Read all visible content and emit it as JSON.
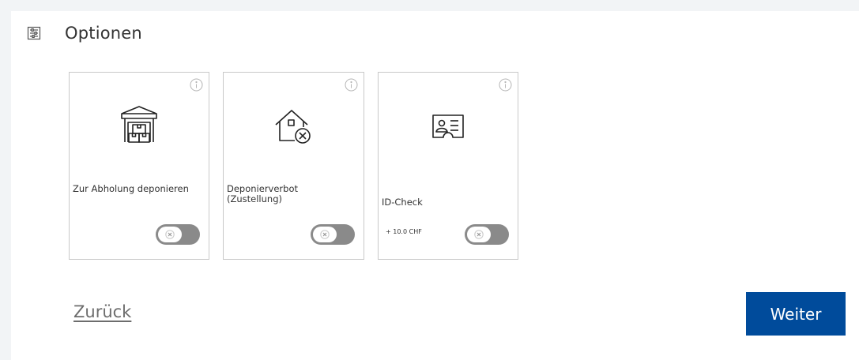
{
  "section": {
    "title": "Optionen",
    "icon": "settings-list-icon"
  },
  "options": [
    {
      "label": "Zur Abholung deponieren",
      "icon": "warehouse-pickup-icon",
      "price": "",
      "enabled": false
    },
    {
      "label": "Deponierverbot (Zustellung)",
      "icon": "house-no-deposit-icon",
      "price": "",
      "enabled": false
    },
    {
      "label": "ID-Check",
      "icon": "id-card-icon",
      "price": "+ 10.0 CHF",
      "enabled": false
    }
  ],
  "nav": {
    "back_label": "Zurück",
    "next_label": "Weiter"
  },
  "colors": {
    "accent": "#004b9b",
    "toggle_off": "#8a8a8a",
    "background": "#f2f4f6"
  }
}
